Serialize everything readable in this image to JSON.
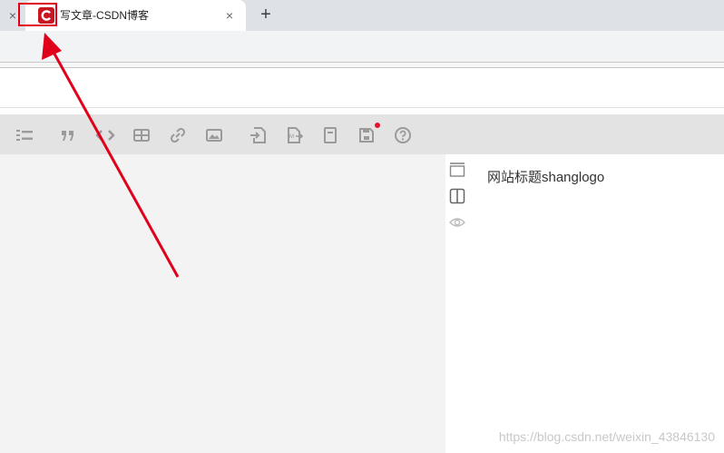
{
  "browser": {
    "prev_tab_close": "×",
    "tab": {
      "title": "写文章-CSDN博客",
      "close": "×",
      "favicon_letter": "C"
    },
    "new_tab": "+"
  },
  "toolbar": {
    "icons": [
      "ordered-list-icon",
      "quote-icon",
      "code-icon",
      "table-icon",
      "link-icon",
      "image-icon",
      "import-icon",
      "export-markdown-icon",
      "draft-icon",
      "save-icon",
      "help-icon"
    ]
  },
  "preview": {
    "text": "网站标题shanglogo",
    "side_icons": [
      "layout-top-icon",
      "split-view-icon",
      "preview-eye-icon"
    ]
  },
  "watermark": "https://blog.csdn.net/weixin_43846130",
  "colors": {
    "accent": "#c81623",
    "annotation": "#e0001b"
  }
}
